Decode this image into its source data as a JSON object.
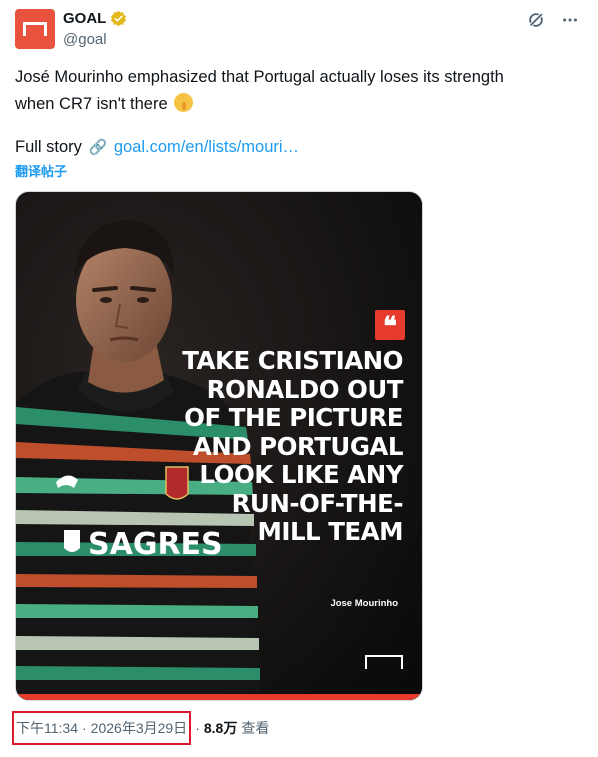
{
  "account": {
    "display_name": "GOAL",
    "handle": "@goal",
    "verified": true,
    "brand_color": "#e8523f",
    "verified_color": "#e2b719"
  },
  "toolbar": {
    "icons": [
      "grok-icon",
      "more-icon"
    ]
  },
  "tweet": {
    "text_line1": "José Mourinho emphasized that Portugal actually loses its strength",
    "text_line2": "when CR7 isn't there",
    "emoji": "shushing-face",
    "story_prefix": "Full story",
    "story_link": "goal.com/en/lists/mouri…",
    "translate_label": "翻译帖子"
  },
  "media": {
    "quote_mark": "❝",
    "quote_lines": [
      "TAKE CRISTIANO",
      "RONALDO OUT",
      "OF THE PICTURE",
      "AND PORTUGAL",
      "LOOK LIKE ANY",
      "RUN-OF-THE-",
      "MILL TEAM"
    ],
    "author": "Jose Mourinho",
    "accent_color": "#e63a2e",
    "shirt_sponsor": "SAGRES"
  },
  "meta": {
    "time": "下午11:34",
    "separator": "·",
    "date": "2026年3月29日",
    "views_count": "8.8万",
    "views_label": "查看",
    "highlight_color": "#e0182d"
  }
}
